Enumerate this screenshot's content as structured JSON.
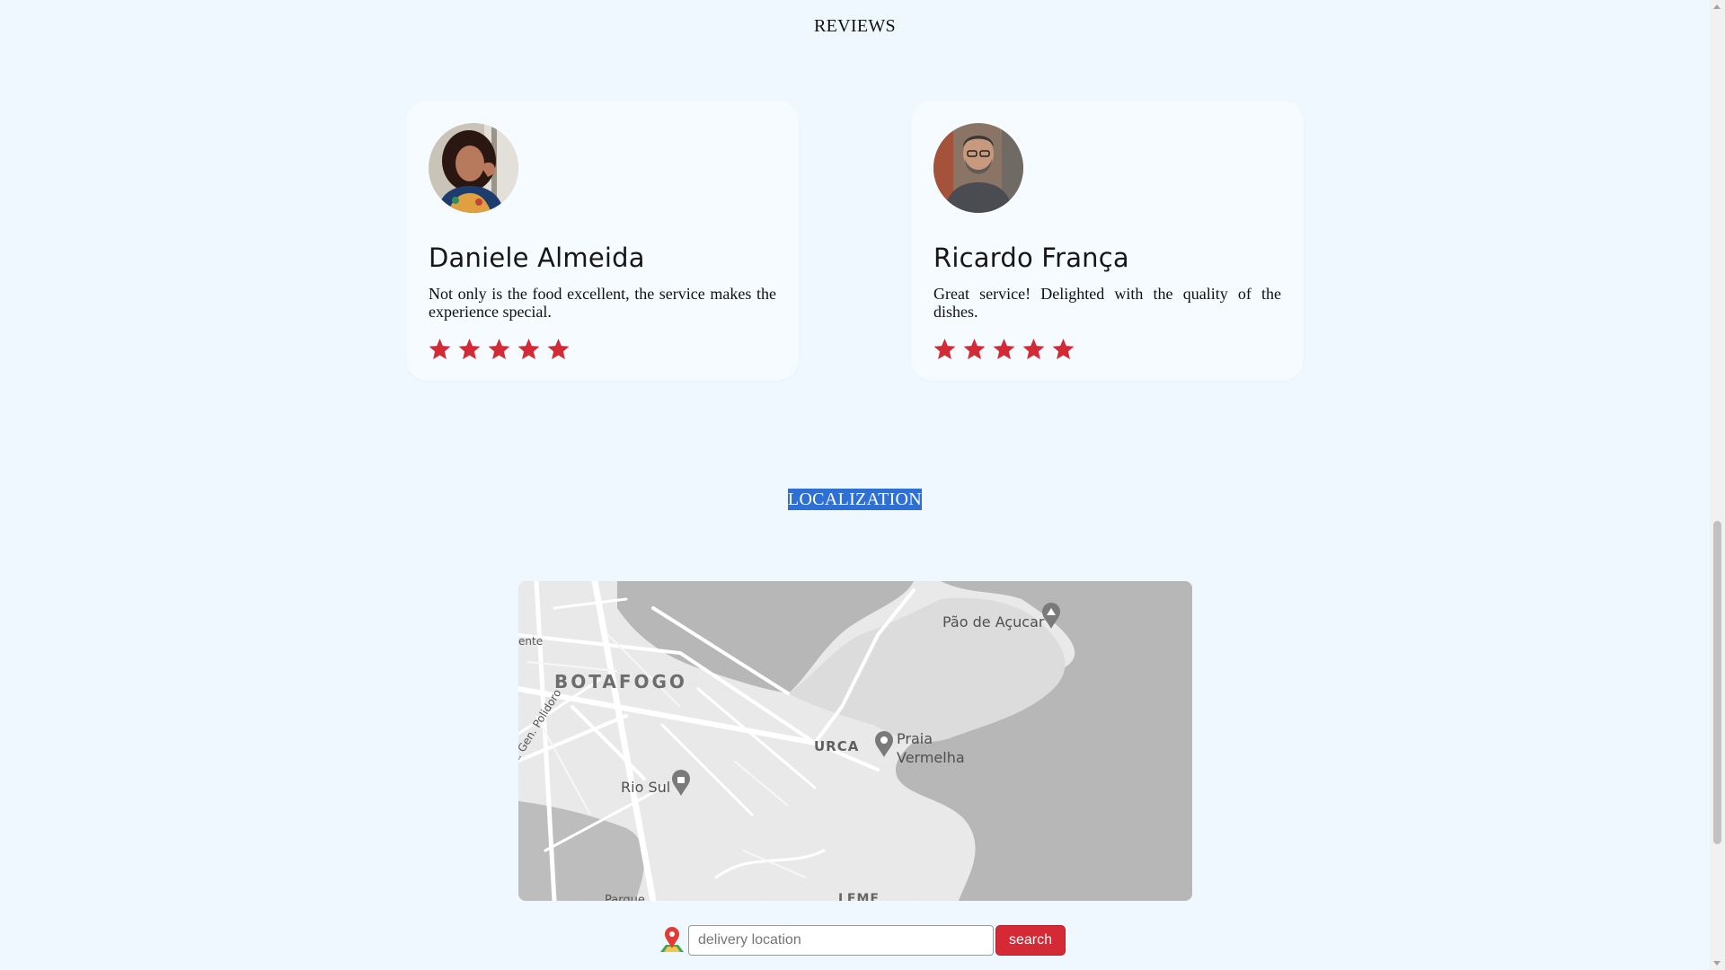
{
  "reviews": {
    "title": "REVIEWS",
    "items": [
      {
        "name": "Daniele Almeida",
        "text": "Not only is the food excellent, the service makes the experience special.",
        "rating": 5
      },
      {
        "name": "Ricardo França",
        "text": "Great service! Delighted with the quality of the dishes.",
        "rating": 5
      }
    ]
  },
  "localization": {
    "title": "LOCALIZATION",
    "map": {
      "labels": {
        "botafogo": "BOTAFOGO",
        "urca": "URCA",
        "pao": "Pão de Açucar",
        "praia_line1": "Praia",
        "praia_line2": "Vermelha",
        "riosul": "Rio Sul",
        "leme": "LEME",
        "ente": "ente",
        "rgen": "R. Gen. Polidoro",
        "parque": "Parque"
      }
    },
    "search": {
      "placeholder": "delivery location",
      "value": "",
      "button_label": "search",
      "pin_icon": "location-pin-icon"
    }
  },
  "colors": {
    "background": "#eff7ff",
    "card": "#f6fbff",
    "star": "#d42a35",
    "button": "#d42a35",
    "highlight": "#2e6fd6"
  }
}
